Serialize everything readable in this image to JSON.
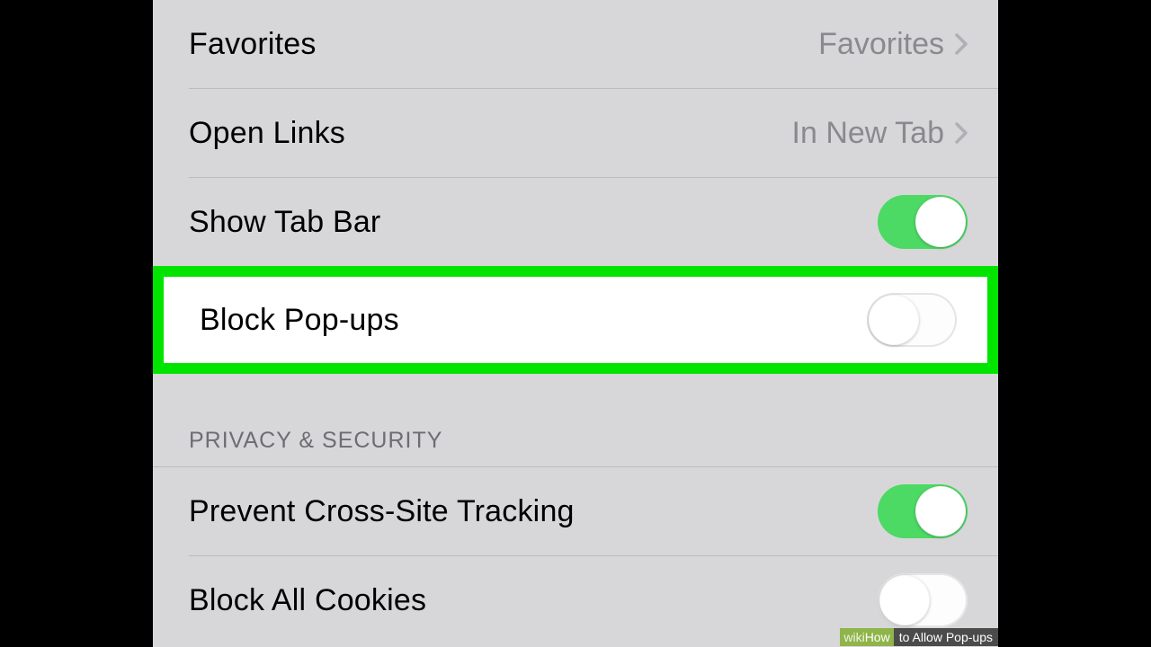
{
  "settings": {
    "favorites": {
      "label": "Favorites",
      "value": "Favorites"
    },
    "open_links": {
      "label": "Open Links",
      "value": "In New Tab"
    },
    "show_tab_bar": {
      "label": "Show Tab Bar",
      "on": true
    },
    "block_popups": {
      "label": "Block Pop-ups",
      "on": false
    }
  },
  "privacy_section": {
    "header": "PRIVACY & SECURITY",
    "prevent_tracking": {
      "label": "Prevent Cross-Site Tracking",
      "on": true
    },
    "block_cookies": {
      "label": "Block All Cookies",
      "on": false
    }
  },
  "watermark": {
    "brand_prefix": "wiki",
    "brand_suffix": "How",
    "title": " to Allow Pop-ups"
  },
  "colors": {
    "highlight": "#00e400",
    "toggle_on": "#4cd964",
    "background": "#d7d7d9",
    "value_text": "#8a8a8e"
  }
}
